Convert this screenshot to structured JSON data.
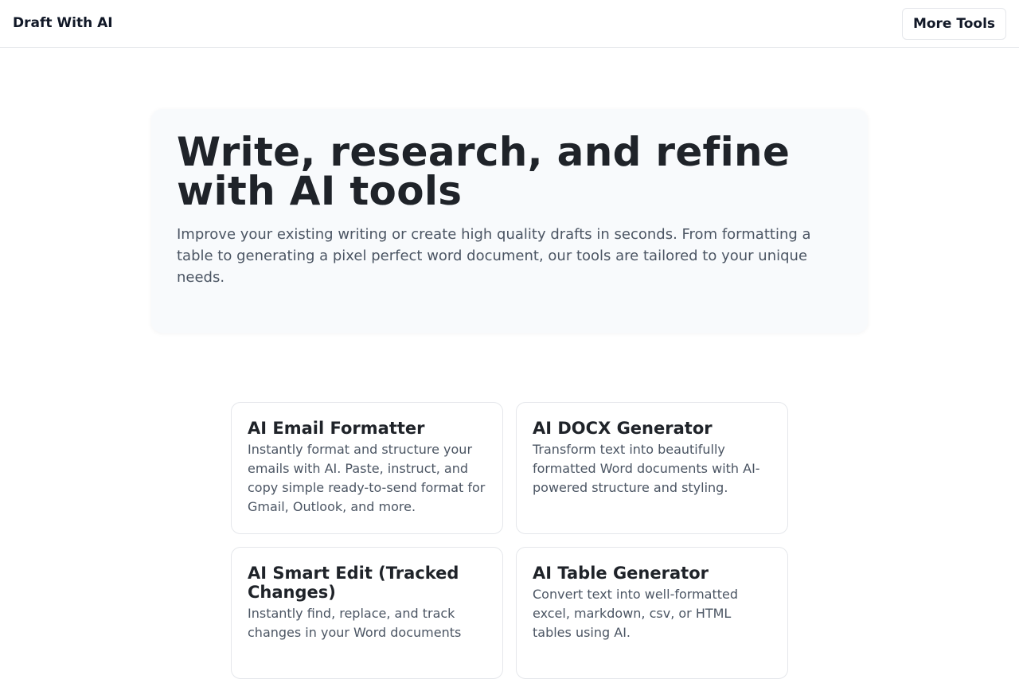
{
  "header": {
    "brand": "Draft With AI",
    "more_tools_label": "More Tools"
  },
  "hero": {
    "title": "Write, research, and refine with AI tools",
    "subtitle": "Improve your existing writing or create high quality drafts in seconds. From formatting a table to generating a pixel perfect word document, our tools are tailored to your unique needs."
  },
  "tools": [
    {
      "title": "AI Email Formatter",
      "description": "Instantly format and structure your emails with AI. Paste, instruct, and copy simple ready-to-send format for Gmail, Outlook, and more."
    },
    {
      "title": "AI DOCX Generator",
      "description": "Transform text into beautifully formatted Word documents with AI-powered structure and styling."
    },
    {
      "title": "AI Smart Edit (Tracked Changes)",
      "description": "Instantly find, replace, and track changes in your Word documents"
    },
    {
      "title": "AI Table Generator",
      "description": "Convert text into well-formatted excel, markdown, csv, or HTML tables using AI."
    }
  ]
}
